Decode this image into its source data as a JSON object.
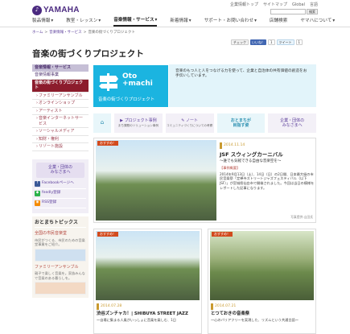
{
  "header": {
    "logo_mark": "♪",
    "logo_text": "YAMAHA",
    "util_links": [
      "企業情報トップ",
      "サイトマップ",
      "Global",
      "言語"
    ],
    "search_button": "検索",
    "search_placeholder": ""
  },
  "gnav": [
    "製品情報",
    "教室・レッスン",
    "音楽情報・サービス",
    "新着情報",
    "サポート・お問い合わせ",
    "店舗検索",
    "ヤマハについて"
  ],
  "breadcrumb": [
    "ホーム",
    "音楽情報・サービス",
    "音楽の街づくりプロジェクト"
  ],
  "social": [
    "チェック",
    "いいね！",
    "1",
    "ツイート",
    "1"
  ],
  "page_title": "音楽の街づくりプロジェクト",
  "sidebar": {
    "header": "音楽情報・サービス",
    "items": [
      {
        "label": "音楽情報事業",
        "state": "normal"
      },
      {
        "label": "音楽の街づくりプロジェクト",
        "state": "selected"
      },
      {
        "label": "ファミリーアンサンブル",
        "state": "sub"
      },
      {
        "label": "オンラインショップ",
        "state": "sub"
      },
      {
        "label": "アーティスト",
        "state": "sub"
      },
      {
        "label": "音楽インターネットサービス",
        "state": "sub"
      },
      {
        "label": "ソーシャルメディア",
        "state": "sub"
      },
      {
        "label": "知財・権利",
        "state": "sub"
      },
      {
        "label": "リゾート施設",
        "state": "sub"
      }
    ],
    "big_link": "企業・団体の\nみなさまへ",
    "links": [
      {
        "label": "Facebookページへ",
        "icon": "facebook-icon",
        "color": "#3b5998"
      },
      {
        "label": "feedly登録",
        "icon": "feedly-icon",
        "color": "#2bb24c"
      },
      {
        "label": "RSS登録",
        "icon": "rss-icon",
        "color": "#f48a00"
      }
    ],
    "topics_header": "おとまちトピックス",
    "topics": [
      {
        "title": "全国の市民音楽堂",
        "desc": "市民がつくる、市民のための音楽堂事業をご紹介。"
      },
      {
        "title": "ファミリーアンサンブル",
        "desc": "親子で楽しく音楽を。家族みんなで音楽のある暮らしを。"
      }
    ]
  },
  "banner": {
    "title": "Oto\n+machi",
    "subtitle": "音楽の街づくりプロジェクト",
    "description": "音楽のもつ人と人をつなげる力を使って、企業と自治体の共有価値の創造をお手伝いしています。"
  },
  "tabs": [
    {
      "label": "⌂",
      "sub": ""
    },
    {
      "label": "プロジェクト事例",
      "sub": "まち課題のソリューション事例"
    },
    {
      "label": "ノート",
      "sub": "コミュニティづくりについての考察"
    },
    {
      "label": "おとまちが\n目指す姿",
      "sub": ""
    },
    {
      "label": "企業・団体の\nみなさまへ",
      "sub": ""
    }
  ],
  "feature": {
    "badge": "おすすめ！",
    "date": "2014.11.14",
    "title": "JSF スウィングカーニバル",
    "subtitle": "～誰でも気軽できる自由な音楽空を～",
    "category": "【事例概要】",
    "body": "2014年9月13日（土）、14日（日）の2日間、日本最大級の市民音楽祭「定禅寺ストリートジャズフェスティバル（以下JSF）」が宮城県仙台市で開催されました。今回は当日の模様をレポートした記事になります。",
    "credit": "写真提供:山田氏"
  },
  "cards": [
    {
      "badge": "おすすめ！",
      "date": "2014.07.28",
      "title": "渋谷ズンチャカ！| SHIBUYA STREET JAZZ",
      "body": "～自場に集まる人風がいっしょに音楽を楽しむ、1日"
    },
    {
      "badge": "おすすめ！",
      "date": "2014.07.21",
      "title": "とつておきの音楽祭",
      "body": "～心のバリアフリーを実現した、リズムという共通言語～"
    }
  ]
}
